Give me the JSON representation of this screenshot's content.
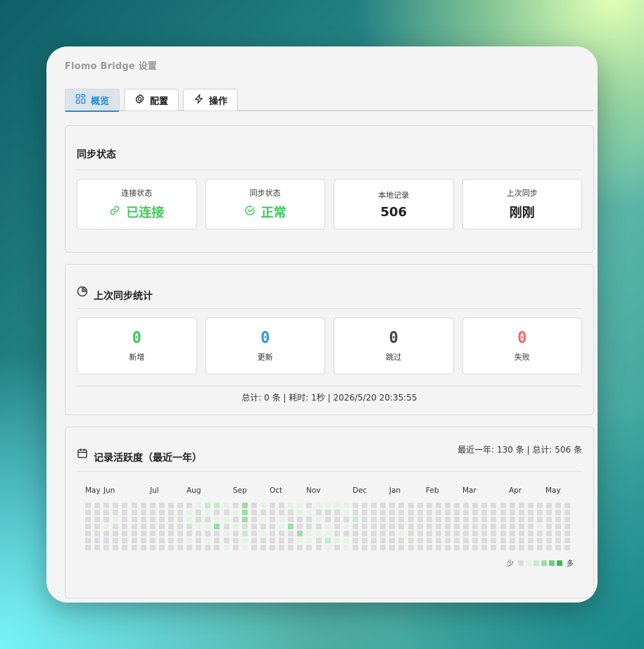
{
  "window": {
    "title": "Flomo Bridge 设置"
  },
  "tabs": [
    {
      "label": "概览",
      "icon": "grid-icon",
      "active": true
    },
    {
      "label": "配置",
      "icon": "gear-icon",
      "active": false
    },
    {
      "label": "操作",
      "icon": "bolt-icon",
      "active": false
    }
  ],
  "sync_status": {
    "title": "同步状态",
    "cards": [
      {
        "label": "连接状态",
        "value": "已连接",
        "icon": "link-icon",
        "color": "#3dc95a"
      },
      {
        "label": "同步状态",
        "value": "正常",
        "icon": "check-circle-icon",
        "color": "#3dc95a"
      },
      {
        "label": "本地记录",
        "value": "506"
      },
      {
        "label": "上次同步",
        "value": "刚刚"
      }
    ]
  },
  "last_sync_stats": {
    "title": "上次同步统计",
    "icon": "pie-chart-icon",
    "stats": [
      {
        "value": "0",
        "label": "新增",
        "color": "#3dc95a"
      },
      {
        "value": "0",
        "label": "更新",
        "color": "#2a9ad9"
      },
      {
        "value": "0",
        "label": "跳过",
        "color": "#444444"
      },
      {
        "value": "0",
        "label": "失败",
        "color": "#ef6a6a"
      }
    ],
    "footer": "总计: 0 条 | 耗时: 1秒 | 2026/5/20 20:35:55"
  },
  "activity": {
    "title": "记录活跃度（最近一年）",
    "icon": "calendar-icon",
    "summary": "最近一年: 130 条 | 总计: 506 条",
    "months": [
      "May",
      "Jun",
      "Jul",
      "Aug",
      "Sep",
      "Oct",
      "Nov",
      "Dec",
      "Jan",
      "Feb",
      "Mar",
      "Apr",
      "May"
    ],
    "legend": {
      "less": "少",
      "more": "多"
    },
    "colors": [
      "#dcdcdc",
      "#e4f4e4",
      "#c6ebc9",
      "#9ddda6",
      "#6fcf81",
      "#3dbb5a"
    ],
    "weeks": [
      [
        0,
        0,
        0,
        0,
        0,
        0,
        0
      ],
      [
        0,
        0,
        0,
        0,
        0,
        0,
        0
      ],
      [
        0,
        0,
        0,
        1,
        0,
        0,
        0
      ],
      [
        0,
        0,
        1,
        0,
        0,
        0,
        0
      ],
      [
        0,
        0,
        0,
        0,
        0,
        0,
        0
      ],
      [
        0,
        0,
        0,
        0,
        0,
        0,
        0
      ],
      [
        0,
        0,
        0,
        0,
        0,
        0,
        0
      ],
      [
        0,
        0,
        0,
        0,
        0,
        0,
        0
      ],
      [
        0,
        0,
        0,
        0,
        0,
        0,
        0
      ],
      [
        0,
        0,
        0,
        0,
        0,
        0,
        0
      ],
      [
        0,
        0,
        0,
        0,
        0,
        0,
        0
      ],
      [
        0,
        1,
        1,
        0,
        0,
        1,
        0
      ],
      [
        1,
        0,
        0,
        1,
        0,
        0,
        0
      ],
      [
        2,
        1,
        0,
        1,
        0,
        1,
        0
      ],
      [
        2,
        0,
        1,
        3,
        0,
        0,
        0
      ],
      [
        1,
        0,
        1,
        0,
        1,
        0,
        1
      ],
      [
        0,
        1,
        0,
        1,
        0,
        0,
        0
      ],
      [
        3,
        3,
        3,
        0,
        2,
        1,
        1
      ],
      [
        0,
        0,
        0,
        0,
        0,
        0,
        0
      ],
      [
        1,
        0,
        1,
        0,
        1,
        0,
        0
      ],
      [
        0,
        0,
        0,
        0,
        0,
        0,
        0
      ],
      [
        0,
        0,
        1,
        1,
        0,
        0,
        0
      ],
      [
        1,
        0,
        0,
        3,
        0,
        0,
        0
      ],
      [
        1,
        1,
        0,
        0,
        3,
        1,
        0
      ],
      [
        0,
        1,
        0,
        0,
        1,
        1,
        0
      ],
      [
        1,
        0,
        1,
        0,
        1,
        0,
        0
      ],
      [
        1,
        0,
        0,
        1,
        1,
        2,
        1
      ],
      [
        1,
        0,
        0,
        0,
        0,
        1,
        0
      ],
      [
        1,
        1,
        0,
        1,
        0,
        1,
        1
      ],
      [
        0,
        0,
        2,
        0,
        0,
        0,
        0
      ],
      [
        0,
        0,
        0,
        0,
        0,
        0,
        0
      ],
      [
        0,
        0,
        0,
        0,
        0,
        0,
        0
      ],
      [
        0,
        0,
        0,
        0,
        0,
        0,
        0
      ],
      [
        0,
        0,
        0,
        0,
        0,
        0,
        0
      ],
      [
        0,
        0,
        0,
        0,
        1,
        0,
        0
      ],
      [
        0,
        0,
        0,
        0,
        0,
        0,
        0
      ],
      [
        0,
        0,
        0,
        0,
        0,
        0,
        0
      ],
      [
        0,
        0,
        0,
        0,
        0,
        0,
        0
      ],
      [
        0,
        0,
        0,
        0,
        0,
        0,
        0
      ],
      [
        0,
        0,
        0,
        0,
        0,
        0,
        0
      ],
      [
        0,
        0,
        0,
        0,
        0,
        0,
        0
      ],
      [
        0,
        0,
        0,
        0,
        0,
        0,
        0
      ],
      [
        0,
        0,
        0,
        0,
        0,
        0,
        0
      ],
      [
        0,
        0,
        0,
        0,
        0,
        0,
        0
      ],
      [
        0,
        0,
        0,
        0,
        0,
        0,
        0
      ],
      [
        0,
        0,
        0,
        0,
        0,
        0,
        0
      ],
      [
        0,
        0,
        0,
        0,
        0,
        0,
        0
      ],
      [
        0,
        0,
        0,
        0,
        0,
        0,
        0
      ],
      [
        0,
        0,
        0,
        0,
        0,
        0,
        0
      ],
      [
        0,
        0,
        0,
        1,
        0,
        0,
        0
      ],
      [
        0,
        0,
        0,
        0,
        0,
        0,
        0
      ],
      [
        0,
        0,
        0,
        0,
        0,
        0,
        0
      ],
      [
        0,
        0,
        0,
        0,
        0,
        0,
        0
      ]
    ]
  }
}
